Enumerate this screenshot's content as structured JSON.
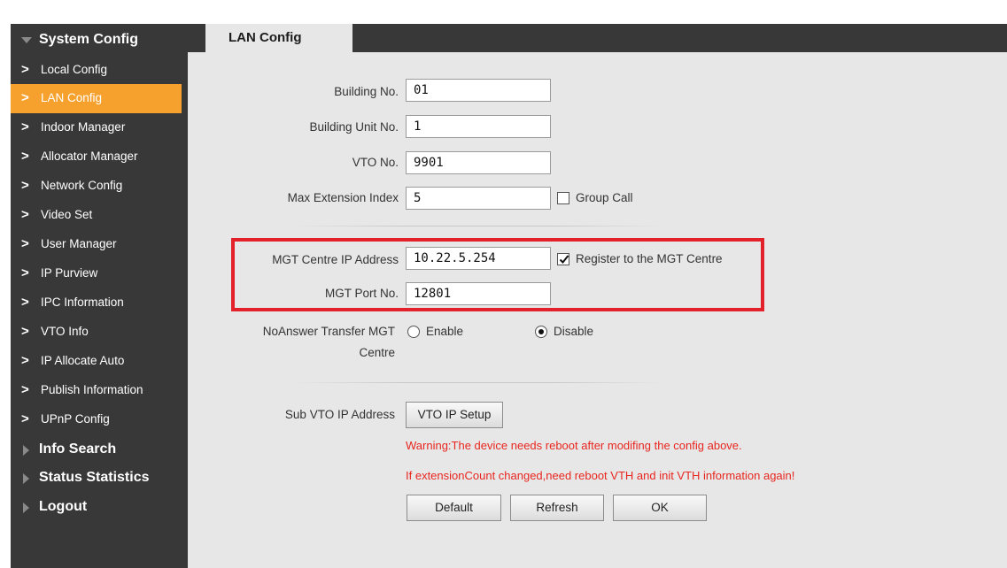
{
  "sidebar": {
    "groups": [
      {
        "label": "System Config"
      },
      {
        "label": "Info Search"
      },
      {
        "label": "Status Statistics"
      },
      {
        "label": "Logout"
      }
    ],
    "items": [
      {
        "label": "Local Config"
      },
      {
        "label": "LAN Config"
      },
      {
        "label": "Indoor Manager"
      },
      {
        "label": "Allocator Manager"
      },
      {
        "label": "Network Config"
      },
      {
        "label": "Video Set"
      },
      {
        "label": "User Manager"
      },
      {
        "label": "IP Purview"
      },
      {
        "label": "IPC Information"
      },
      {
        "label": "VTO Info"
      },
      {
        "label": "IP Allocate Auto"
      },
      {
        "label": "Publish Information"
      },
      {
        "label": "UPnP Config"
      }
    ],
    "active_item": "LAN Config",
    "chevron": ">"
  },
  "tab": {
    "label": "LAN Config"
  },
  "form": {
    "building_no": {
      "label": "Building No.",
      "value": "01"
    },
    "building_unit_no": {
      "label": "Building Unit No.",
      "value": "1"
    },
    "vto_no": {
      "label": "VTO No.",
      "value": "9901"
    },
    "max_extension_index": {
      "label": "Max Extension Index",
      "value": "5"
    },
    "group_call": {
      "label": "Group Call",
      "checked": false
    },
    "mgt_ip": {
      "label": "MGT Centre IP Address",
      "value": "10.22.5.254"
    },
    "register_mgt": {
      "label": "Register to the MGT Centre",
      "checked": true
    },
    "mgt_port": {
      "label": "MGT Port No.",
      "value": "12801"
    },
    "noanswer": {
      "label_line1": "NoAnswer Transfer MGT",
      "label_line2": "Centre",
      "enable_label": "Enable",
      "disable_label": "Disable",
      "selected": "Disable"
    },
    "sub_vto": {
      "label": "Sub VTO IP Address",
      "button": "VTO IP Setup"
    },
    "warnings": [
      "Warning:The device needs reboot after modifing the config above.",
      "If extensionCount changed,need reboot VTH and init VTH information again!"
    ],
    "buttons": {
      "default": "Default",
      "refresh": "Refresh",
      "ok": "OK"
    }
  },
  "colors": {
    "sidebar_bg": "#383838",
    "active_bg": "#f6a12d",
    "content_bg": "#e7e7e7",
    "warning": "#e8261f",
    "highlight_box": "#e3212b"
  }
}
